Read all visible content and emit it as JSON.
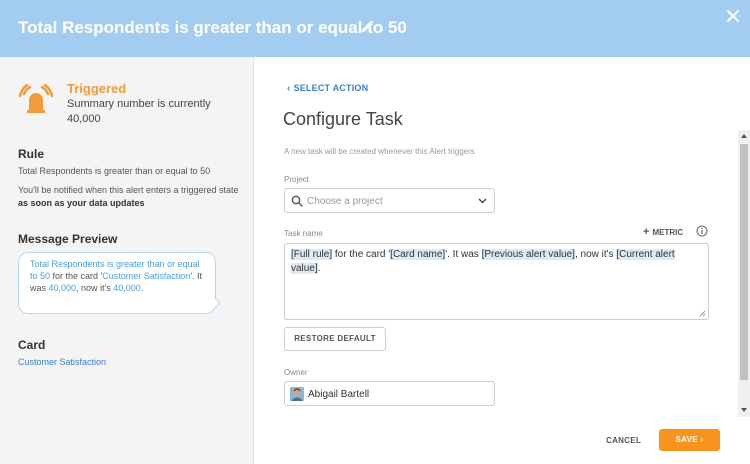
{
  "header": {
    "title": "Total Respondents is greater than or equal to 50"
  },
  "sidebar": {
    "status_label": "Triggered",
    "summary_text": "Summary number is currently 40,000",
    "rule_title": "Rule",
    "rule_text": "Total Respondents is greater than or equal to 50",
    "notify_prefix": "You'll be notified when this alert enters a triggered state",
    "notify_bold": "as soon as your data updates",
    "preview_title": "Message Preview",
    "preview": {
      "part1": "Total Respondents is greater than or equal to 50",
      "part2": " for the card '",
      "part3": "Customer Satisfaction",
      "part4": "'. It was ",
      "part5": "40,000",
      "part6": ", now it's ",
      "part7": "40,000",
      "part8": "."
    },
    "card_title": "Card",
    "card_link": "Customer Satisfaction"
  },
  "main": {
    "back_label": "SELECT ACTION",
    "title": "Configure Task",
    "description": "A new task will be created whenever this Alert triggers",
    "project_label": "Project",
    "project_placeholder": "Choose a project",
    "task_name_label": "Task name",
    "metric_label": "METRIC",
    "task_text": {
      "t1": "[Full rule]",
      "t2": " for the card '",
      "t3": "[Card name]",
      "t4": "'.  It was ",
      "t5": "[Previous alert value]",
      "t6": ", now it's ",
      "t7": "[Current alert value]",
      "t8": "."
    },
    "restore_label": "RESTORE DEFAULT",
    "owner_label": "Owner",
    "owner_name": "Abigail Bartell",
    "cancel_label": "CANCEL",
    "save_label": "SAVE"
  },
  "colors": {
    "header_bg": "#a3cdf0",
    "accent_orange": "#f7941d",
    "triggered_orange": "#f39a3a",
    "link_blue": "#3b7fc4",
    "token_bg": "#dbeaf7"
  },
  "icons": [
    "edit-icon",
    "close-icon",
    "alarm-icon",
    "search-icon",
    "chevron-down-icon",
    "info-icon",
    "chevron-right-icon",
    "chevron-left-icon"
  ]
}
